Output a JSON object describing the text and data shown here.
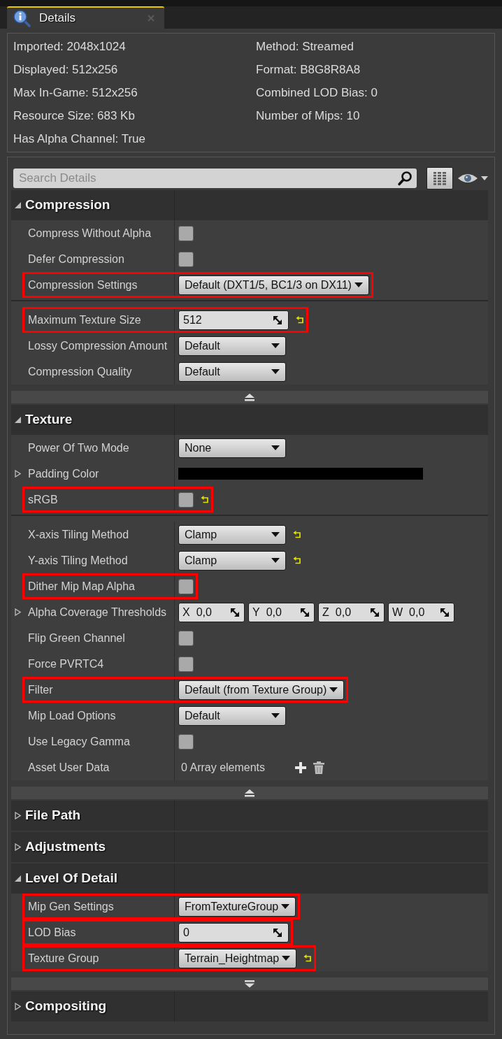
{
  "tabs": [
    {
      "label": "Details",
      "selected": true
    }
  ],
  "info": [
    {
      "left": "Imported: 2048x1024",
      "right": "Method: Streamed"
    },
    {
      "left": "Displayed: 512x256",
      "right": "Format: B8G8R8A8"
    },
    {
      "left": "Max In-Game: 512x256",
      "right": "Combined LOD Bias: 0"
    },
    {
      "left": "Resource Size: 683 Kb",
      "right": "Number of Mips: 10"
    },
    {
      "left": "Has Alpha Channel: True"
    }
  ],
  "search": {
    "placeholder": "Search Details"
  },
  "categories": [
    {
      "title": "Compression",
      "expanded": true,
      "advanced_expanded": true,
      "rows": [
        {
          "label": "Compress Without Alpha",
          "kind": "checkbox",
          "checked": false,
          "highlighted": false,
          "reset": false
        },
        {
          "label": "Defer Compression",
          "kind": "checkbox",
          "checked": false,
          "highlighted": false,
          "reset": false
        },
        {
          "label": "Compression Settings",
          "kind": "combo",
          "value": "Default (DXT1/5, BC1/3 on DX11)",
          "highlighted": true,
          "reset": false
        }
      ],
      "advanced_rows": [
        {
          "label": "Maximum Texture Size",
          "kind": "number",
          "value": "512",
          "highlighted": true,
          "reset": true
        },
        {
          "label": "Lossy Compression Amount",
          "kind": "combo",
          "value": "Default",
          "highlighted": false,
          "reset": false
        },
        {
          "label": "Compression Quality",
          "kind": "combo",
          "value": "Default",
          "highlighted": false,
          "reset": false
        }
      ]
    },
    {
      "title": "Texture",
      "expanded": true,
      "advanced_expanded": true,
      "rows": [
        {
          "label": "Power Of Two Mode",
          "kind": "combo",
          "value": "None",
          "highlighted": false,
          "reset": false
        },
        {
          "label": "Padding Color",
          "kind": "color",
          "color": "#000000",
          "expanded": false,
          "highlighted": false,
          "reset": false
        },
        {
          "label": "sRGB",
          "kind": "checkbox",
          "checked": false,
          "highlighted": true,
          "reset": true
        }
      ],
      "advanced_rows": [
        {
          "label": "X-axis Tiling Method",
          "kind": "combo",
          "value": "Clamp",
          "highlighted": false,
          "reset": true
        },
        {
          "label": "Y-axis Tiling Method",
          "kind": "combo",
          "value": "Clamp",
          "highlighted": false,
          "reset": true
        },
        {
          "label": "Dither Mip Map Alpha",
          "kind": "checkbox",
          "checked": false,
          "highlighted": true,
          "reset": false
        },
        {
          "label": "Alpha Coverage Thresholds",
          "kind": "vector",
          "expanded": false,
          "components": [
            {
              "axis": "X",
              "value": "0,0"
            },
            {
              "axis": "Y",
              "value": "0,0"
            },
            {
              "axis": "Z",
              "value": "0,0"
            },
            {
              "axis": "W",
              "value": "0,0"
            }
          ],
          "highlighted": false,
          "reset": false
        },
        {
          "label": "Flip Green Channel",
          "kind": "checkbox",
          "checked": false,
          "highlighted": false,
          "reset": false
        },
        {
          "label": "Force PVRTC4",
          "kind": "checkbox",
          "checked": false,
          "highlighted": false,
          "reset": false
        },
        {
          "label": "Filter",
          "kind": "combo",
          "value": "Default (from Texture Group)",
          "highlighted": true,
          "reset": false
        },
        {
          "label": "Mip Load Options",
          "kind": "combo",
          "value": "Default",
          "highlighted": false,
          "reset": false
        },
        {
          "label": "Use Legacy Gamma",
          "kind": "checkbox",
          "checked": false,
          "highlighted": false,
          "reset": false
        },
        {
          "label": "Asset User Data",
          "kind": "array",
          "value": "0 Array elements",
          "highlighted": false,
          "reset": false
        }
      ]
    },
    {
      "title": "File Path",
      "expanded": false
    },
    {
      "title": "Adjustments",
      "expanded": false
    },
    {
      "title": "Level Of Detail",
      "expanded": true,
      "advanced_expanded": false,
      "rows": [
        {
          "label": "Mip Gen Settings",
          "kind": "combo",
          "value": "FromTextureGroup",
          "highlighted": true,
          "reset": false
        },
        {
          "label": "LOD Bias",
          "kind": "number",
          "value": "0",
          "highlighted": true,
          "reset": false
        },
        {
          "label": "Texture Group",
          "kind": "combo",
          "value": "Terrain_Heightmap",
          "highlighted": true,
          "reset": true
        }
      ]
    },
    {
      "title": "Compositing",
      "expanded": false
    }
  ]
}
